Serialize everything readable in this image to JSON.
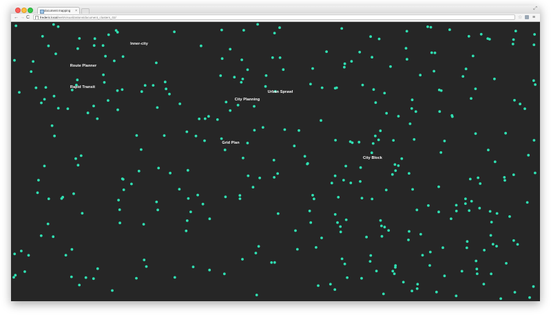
{
  "browser": {
    "tab_title": "document mapping",
    "tab_close": "×",
    "url_host": "frederic.local",
    "url_path": "/web/visualizations/document_clusters_02/",
    "nav_back": "←",
    "nav_forward": "→",
    "nav_reload": "C",
    "star": "☆",
    "menu": "≡",
    "fullscreen": "⤢"
  },
  "map": {
    "background": "#262626",
    "dot_color": "#2fe0b2",
    "labels": [
      "Inner-city",
      "Route Planner",
      "Rapid Transit",
      "City Planning",
      "Urban Sprawl",
      "Grid Plan",
      "City Block"
    ]
  }
}
